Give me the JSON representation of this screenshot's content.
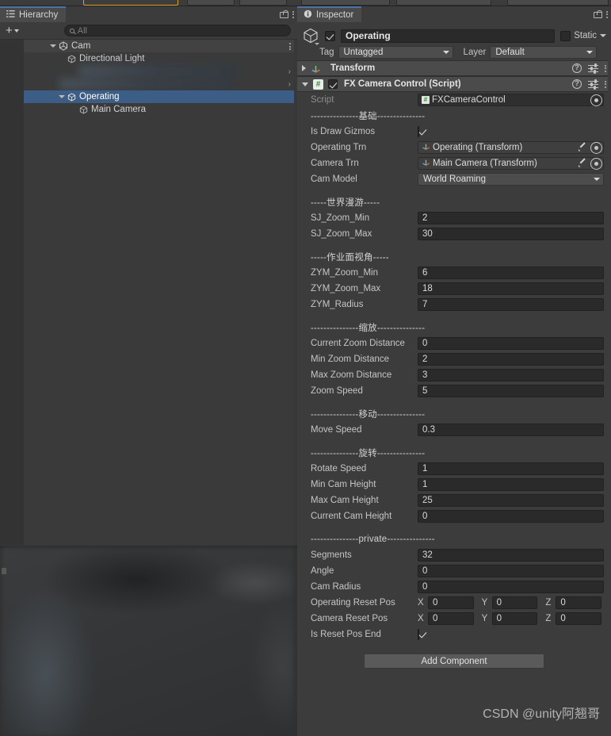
{
  "toolbar": {
    "chips": [
      "",
      "",
      "",
      "",
      ""
    ]
  },
  "hierarchy": {
    "tab_label": "Hierarchy",
    "tab_icon": "hierarchy-icon",
    "lock_icon": "lock-icon",
    "menu_icon": "kebab-menu-icon",
    "add_label": "+",
    "search": {
      "placeholder": "All",
      "value": "",
      "icon": "search-icon"
    },
    "items": [
      {
        "label": "Cam",
        "icon": "unity-scene-icon",
        "indent": 0,
        "expanded": true,
        "selected": false,
        "state": "scene-root"
      },
      {
        "label": "Directional Light",
        "icon": "gameobject-cube-icon",
        "indent": 1,
        "expanded": false,
        "selected": false,
        "state": "normal"
      },
      {
        "label": "",
        "icon": "",
        "indent": 1,
        "expanded": false,
        "selected": false,
        "state": "blurred"
      },
      {
        "label": "",
        "icon": "",
        "indent": 1,
        "expanded": false,
        "selected": false,
        "state": "blurred"
      },
      {
        "label": "Operating",
        "icon": "gameobject-cube-icon",
        "indent": 1,
        "expanded": true,
        "selected": true,
        "state": "normal"
      },
      {
        "label": "Main Camera",
        "icon": "gameobject-cube-icon",
        "indent": 2,
        "expanded": false,
        "selected": false,
        "state": "normal"
      }
    ]
  },
  "inspector": {
    "tab_label": "Inspector",
    "tab_icon": "info-icon",
    "lock_icon": "lock-icon",
    "menu_icon": "kebab-menu-icon",
    "gameobject": {
      "enabled": true,
      "name": "Operating",
      "static_label": "Static",
      "static_checked": false,
      "tag_label": "Tag",
      "tag_value": "Untagged",
      "layer_label": "Layer",
      "layer_value": "Default"
    },
    "components": [
      {
        "title": "Transform",
        "expanded": false,
        "icon": "transform-axis-icon",
        "has_enable_toggle": false
      },
      {
        "title": "FX Camera Control (Script)",
        "expanded": true,
        "icon": "cs-script-icon",
        "has_enable_toggle": true,
        "enabled": true
      }
    ],
    "script_row": {
      "label": "Script",
      "value": "FXCameraControl"
    },
    "properties": [
      {
        "kind": "separator",
        "label": "---------------基础---------------"
      },
      {
        "kind": "bool",
        "label": "Is Draw Gizmos",
        "value": true
      },
      {
        "kind": "object",
        "label": "Operating Trn",
        "value": "Operating (Transform)"
      },
      {
        "kind": "object",
        "label": "Camera Trn",
        "value": "Main Camera (Transform)"
      },
      {
        "kind": "enum",
        "label": "Cam Model",
        "value": "World Roaming"
      },
      {
        "kind": "spacer"
      },
      {
        "kind": "separator",
        "label": "-----世界漫游-----"
      },
      {
        "kind": "text",
        "label": "SJ_Zoom_Min",
        "value": "2"
      },
      {
        "kind": "text",
        "label": "SJ_Zoom_Max",
        "value": "30"
      },
      {
        "kind": "spacer"
      },
      {
        "kind": "separator",
        "label": "-----作业面视角-----"
      },
      {
        "kind": "text",
        "label": "ZYM_Zoom_Min",
        "value": "6"
      },
      {
        "kind": "text",
        "label": "ZYM_Zoom_Max",
        "value": "18"
      },
      {
        "kind": "text",
        "label": "ZYM_Radius",
        "value": "7"
      },
      {
        "kind": "spacer"
      },
      {
        "kind": "separator",
        "label": "---------------缩放---------------"
      },
      {
        "kind": "text",
        "label": "Current Zoom Distance",
        "value": "0"
      },
      {
        "kind": "text",
        "label": "Min Zoom Distance",
        "value": "2"
      },
      {
        "kind": "text",
        "label": "Max Zoom Distance",
        "value": "3"
      },
      {
        "kind": "text",
        "label": "Zoom Speed",
        "value": "5"
      },
      {
        "kind": "spacer"
      },
      {
        "kind": "separator",
        "label": "---------------移动---------------"
      },
      {
        "kind": "text",
        "label": "Move Speed",
        "value": "0.3"
      },
      {
        "kind": "spacer"
      },
      {
        "kind": "separator",
        "label": "---------------旋转---------------"
      },
      {
        "kind": "text",
        "label": "Rotate Speed",
        "value": "1"
      },
      {
        "kind": "text",
        "label": "Min Cam Height",
        "value": "1"
      },
      {
        "kind": "text",
        "label": "Max Cam Height",
        "value": "25"
      },
      {
        "kind": "text",
        "label": "Current Cam Height",
        "value": "0"
      },
      {
        "kind": "spacer"
      },
      {
        "kind": "separator",
        "label": "---------------private---------------"
      },
      {
        "kind": "text",
        "label": "Segments",
        "value": "32"
      },
      {
        "kind": "text",
        "label": "Angle",
        "value": "0"
      },
      {
        "kind": "text",
        "label": "Cam Radius",
        "value": "0"
      },
      {
        "kind": "vector3",
        "label": "Operating Reset Pos",
        "axes": [
          "X",
          "Y",
          "Z"
        ],
        "values": [
          "0",
          "0",
          "0"
        ]
      },
      {
        "kind": "vector3",
        "label": "Camera Reset Pos",
        "axes": [
          "X",
          "Y",
          "Z"
        ],
        "values": [
          "0",
          "0",
          "0"
        ]
      },
      {
        "kind": "bool",
        "label": "Is Reset Pos End",
        "value": true
      }
    ],
    "add_component_label": "Add Component"
  },
  "watermark": "CSDN @unity阿翘哥",
  "colors": {
    "panel_bg": "#383838",
    "inspector_bg": "#3c3c3c",
    "component_header": "#4b4b4b",
    "selection_blue": "#3c5d85",
    "field_bg": "#2a2a2a",
    "tab_accent": "#4a74a8",
    "toolbar_active": "#e0a020"
  }
}
